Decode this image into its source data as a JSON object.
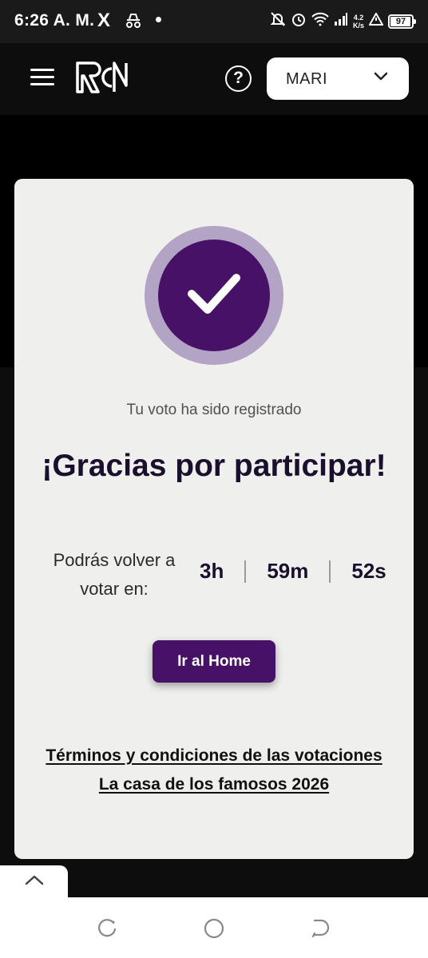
{
  "status_bar": {
    "time": "6:26 A. M.",
    "x_app": "X",
    "speed_value": "4.2",
    "speed_unit": "K/s",
    "battery": "97",
    "battery_level": 0.97
  },
  "header": {
    "logo": "RCN",
    "help": "?",
    "user_name": "MARI"
  },
  "card": {
    "subtitle": "Tu voto ha sido registrado",
    "title": "¡Gracias por participar!",
    "again_label": "Podrás volver a votar en:",
    "timer": {
      "hours": "3h",
      "minutes": "59m",
      "seconds": "52s"
    },
    "home_button": "Ir al Home",
    "terms_line1": "Términos y condiciones de las votaciones",
    "terms_line2": "La casa de los famosos 2026"
  },
  "colors": {
    "accent": "#461166",
    "ring": "#b3a3c4",
    "card_bg": "#efefed",
    "page_bg": "#0d0d0e"
  },
  "icons": {
    "menu": "hamburger-icon",
    "help": "question-circle-icon",
    "dropdown": "chevron-down-icon",
    "success": "checkmark-icon",
    "scroll_top": "chevron-up-icon"
  }
}
